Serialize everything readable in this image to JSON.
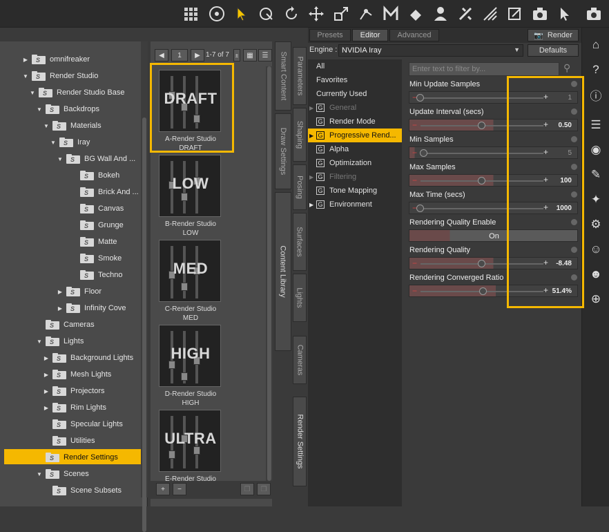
{
  "colors": {
    "highlight": "#f5b800",
    "panel": "#4a4a4a",
    "dark": "#2b2b2b"
  },
  "toolbar": {
    "icons": [
      "grid-icon",
      "universal-move-icon",
      "node-selection-icon",
      "rotate-camera-icon",
      "rotate-icon",
      "translate-icon",
      "scale-icon",
      "joint-editor-icon",
      "geometry-editor-icon",
      "surface-selection-icon",
      "figure-tool-icon",
      "spot-render-icon",
      "edit-node-icon",
      "render-icon",
      "viewport-select-icon",
      "camera-icon"
    ]
  },
  "tree": {
    "items": [
      {
        "label": "omnifreaker"
      },
      {
        "label": "Render Studio"
      },
      {
        "label": "Render Studio Base"
      },
      {
        "label": "Backdrops"
      },
      {
        "label": "Materials"
      },
      {
        "label": "Iray"
      },
      {
        "label": "BG Wall And ..."
      },
      {
        "label": "Bokeh"
      },
      {
        "label": "Brick And ..."
      },
      {
        "label": "Canvas"
      },
      {
        "label": "Grunge"
      },
      {
        "label": "Matte"
      },
      {
        "label": "Smoke"
      },
      {
        "label": "Techno"
      },
      {
        "label": "Floor"
      },
      {
        "label": "Infinity Cove"
      },
      {
        "label": "Cameras"
      },
      {
        "label": "Lights"
      },
      {
        "label": "Background Lights"
      },
      {
        "label": "Mesh Lights"
      },
      {
        "label": "Projectors"
      },
      {
        "label": "Rim Lights"
      },
      {
        "label": "Specular Lights"
      },
      {
        "label": "Utilities"
      },
      {
        "label": "Render Settings"
      },
      {
        "label": "Scenes"
      },
      {
        "label": "Scene Subsets"
      }
    ]
  },
  "content": {
    "page": "1",
    "range": "1-7 of 7",
    "cards": [
      {
        "title": "DRAFT",
        "caption1": "A-Render Studio",
        "caption2": "DRAFT"
      },
      {
        "title": "LOW",
        "caption1": "B-Render Studio",
        "caption2": "LOW"
      },
      {
        "title": "MED",
        "caption1": "C-Render Studio",
        "caption2": "MED"
      },
      {
        "title": "HIGH",
        "caption1": "D-Render Studio",
        "caption2": "HIGH"
      },
      {
        "title": "ULTRA",
        "caption1": "E-Render Studio",
        "caption2": ""
      }
    ],
    "add": "+",
    "remove": "−"
  },
  "vtabs_left": [
    "Smart Content",
    "Draw Settings",
    "Content Library"
  ],
  "vtabs_right": [
    "Parameters",
    "Shaping",
    "Posing",
    "Surfaces",
    "Lights",
    "Cameras",
    "Render Settings"
  ],
  "render": {
    "tabs": [
      "Presets",
      "Editor",
      "Advanced"
    ],
    "render_label": "Render",
    "engine_label": "Engine :",
    "engine_value": "NVIDIA Iray",
    "defaults_label": "Defaults",
    "filter_placeholder": "Enter text to filter by...",
    "categories": [
      {
        "label": "All"
      },
      {
        "label": "Favorites"
      },
      {
        "label": "Currently Used"
      },
      {
        "label": "General"
      },
      {
        "label": "Render Mode"
      },
      {
        "label": "Progressive Rend..."
      },
      {
        "label": "Alpha"
      },
      {
        "label": "Optimization"
      },
      {
        "label": "Filtering"
      },
      {
        "label": "Tone Mapping"
      },
      {
        "label": "Environment"
      }
    ],
    "properties": [
      {
        "label": "Min Update Samples",
        "value": "1",
        "level": 0.0
      },
      {
        "label": "Update Interval (secs)",
        "value": "0.50",
        "level": 0.5
      },
      {
        "label": "Min Samples",
        "value": "5",
        "level": 0.03
      },
      {
        "label": "Max Samples",
        "value": "100",
        "level": 0.5
      },
      {
        "label": "Max Time (secs)",
        "value": "1000",
        "level": 0.0
      },
      {
        "label": "Rendering Quality Enable",
        "value": "On",
        "level": null
      },
      {
        "label": "Rendering Quality",
        "value": "-8.48",
        "level": 0.5
      },
      {
        "label": "Rendering Converged Ratio",
        "value": "51.4%",
        "level": 0.514
      }
    ]
  }
}
